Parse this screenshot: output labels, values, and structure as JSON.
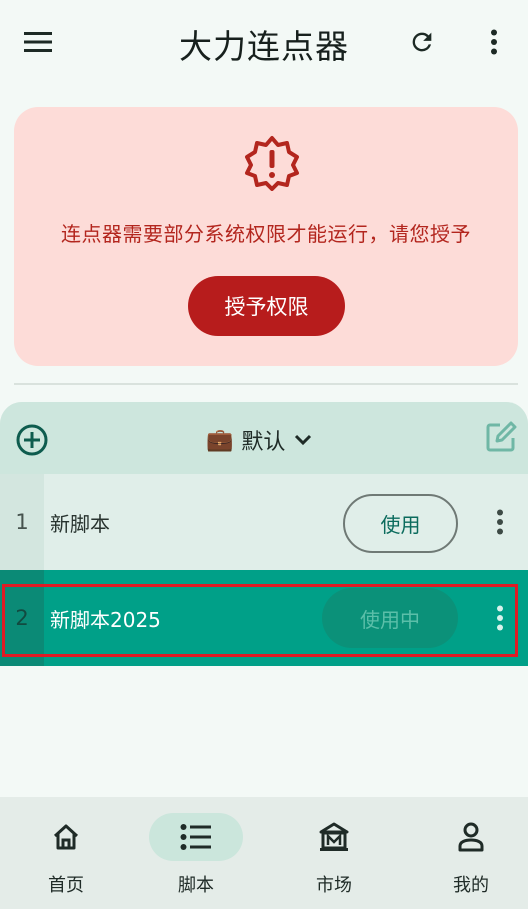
{
  "appbar": {
    "title": "大力连点器"
  },
  "permission_card": {
    "message": "连点器需要部分系统权限才能运行，请您授予",
    "button_label": "授予权限"
  },
  "scripts": {
    "group_emoji": "💼",
    "group_name": "默认",
    "rows": [
      {
        "index": "1",
        "name": "新脚本",
        "action_label": "使用"
      },
      {
        "index": "2",
        "name": "新脚本2025",
        "action_label": "使用中"
      }
    ]
  },
  "bottom_nav": {
    "items": [
      {
        "label": "首页",
        "icon": "home-icon"
      },
      {
        "label": "脚本",
        "icon": "list-icon"
      },
      {
        "label": "市场",
        "icon": "market-icon"
      },
      {
        "label": "我的",
        "icon": "person-icon"
      }
    ],
    "active_index": 1
  },
  "colors": {
    "accent": "#00a088",
    "danger": "#b71c1c",
    "card_bg": "#fddcd8"
  }
}
